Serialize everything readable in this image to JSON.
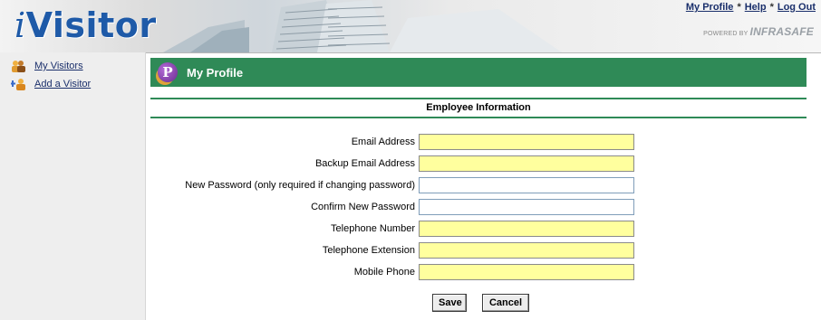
{
  "header": {
    "logo_prefix": "i",
    "logo_text": "Visitor",
    "links": [
      "My Profile",
      "Help",
      "Log Out"
    ],
    "link_separator": "*",
    "powered_by": "POWERED BY",
    "powered_brand": "INFRASAFE"
  },
  "sidebar": {
    "items": [
      {
        "label": "My Visitors",
        "icon": "visitors-icon"
      },
      {
        "label": "Add a Visitor",
        "icon": "add-visitor-icon"
      }
    ]
  },
  "page": {
    "title_badge": "P",
    "title": "My Profile",
    "section_title": "Employee Information"
  },
  "form": {
    "fields": [
      {
        "label": "Email Address",
        "value": "",
        "required": true
      },
      {
        "label": "Backup Email Address",
        "value": "",
        "required": true
      },
      {
        "label": "New Password (only required if changing password)",
        "value": "",
        "required": false
      },
      {
        "label": "Confirm New Password",
        "value": "",
        "required": false
      },
      {
        "label": "Telephone Number",
        "value": "",
        "required": true
      },
      {
        "label": "Telephone Extension",
        "value": "",
        "required": true
      },
      {
        "label": "Mobile Phone",
        "value": "",
        "required": true
      }
    ],
    "save_label": "Save",
    "cancel_label": "Cancel"
  },
  "colors": {
    "accent_green": "#2f8a57",
    "required_field": "#ffff9e",
    "link_blue": "#1a2f6b",
    "logo_blue": "#1e5aa8"
  }
}
